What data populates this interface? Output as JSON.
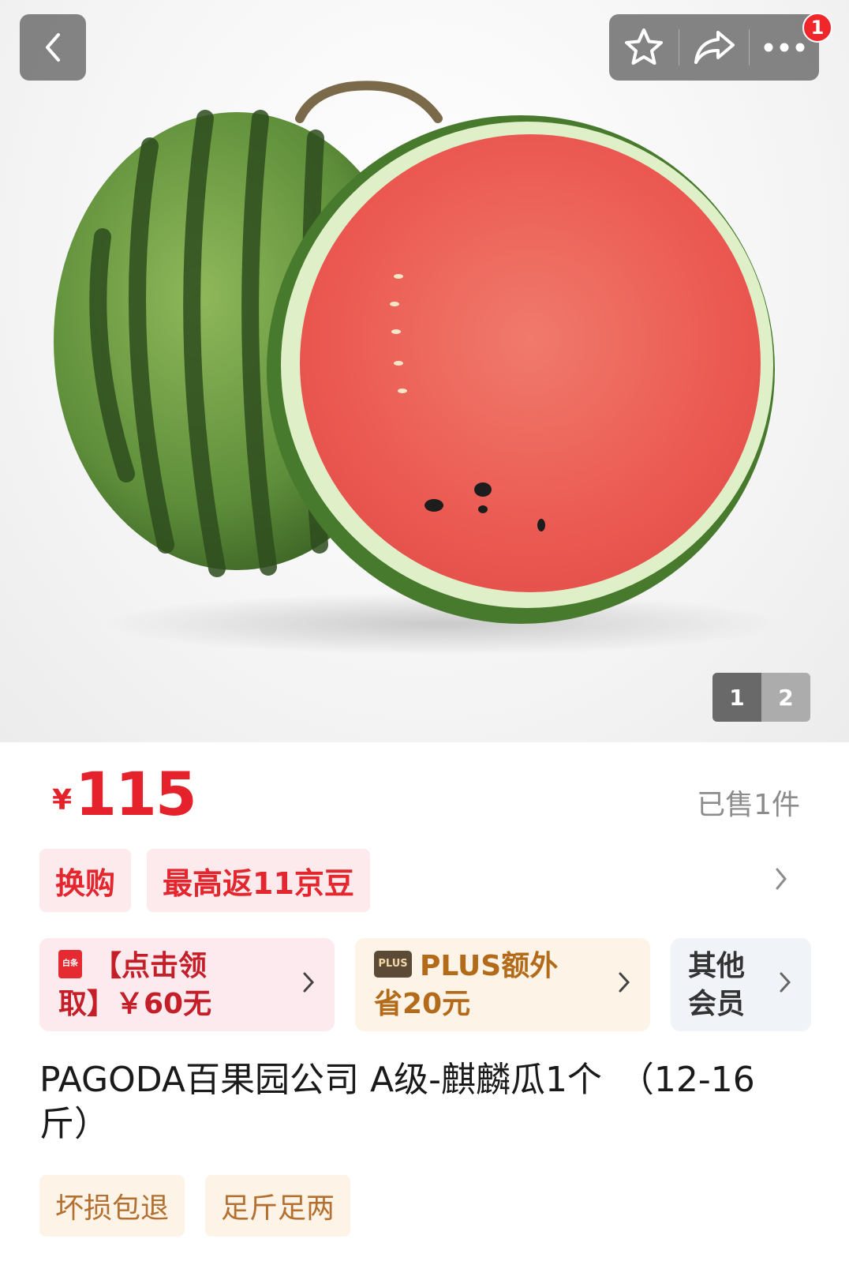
{
  "gallery": {
    "current_page": "1",
    "next_page": "2",
    "notification_count": "1"
  },
  "price": {
    "currency": "¥",
    "amount": "115",
    "sold_text": "已售1件"
  },
  "promos": {
    "tag1": "换购",
    "tag2": "最高返11京豆"
  },
  "coupons": [
    {
      "icon_text": "白条",
      "line1": "【点击领",
      "line2": "取】￥60无"
    },
    {
      "icon_text": "PLUS",
      "line1": "PLUS额外",
      "line2": "省20元"
    },
    {
      "line1": "其他",
      "line2": "会员"
    }
  ],
  "product": {
    "title_line1": "PAGODA百果园公司 A级-麒麟瓜1个　（12-16",
    "title_line2": "斤）"
  },
  "service_tags": [
    "坏损包退",
    "足斤足两"
  ],
  "colors": {
    "price_red": "#e5212b",
    "badge_red": "#f0262a",
    "plus_gold": "#b36b1a"
  },
  "icons": {
    "back": "chevron-left-icon",
    "favorite": "star-icon",
    "share": "share-icon",
    "more": "more-icon",
    "promo_more": "chevron-right-icon"
  }
}
